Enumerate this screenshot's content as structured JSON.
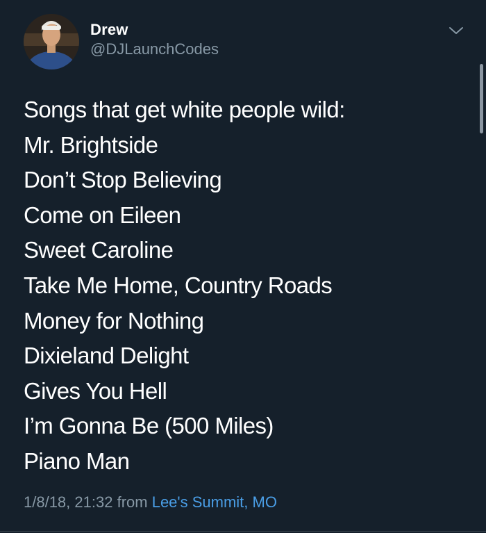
{
  "tweet": {
    "author": {
      "display_name": "Drew",
      "handle": "@DJLaunchCodes"
    },
    "menu_icon": "chevron-down-icon",
    "lines": [
      "Songs that get white people wild:",
      "Mr. Brightside",
      "Don’t Stop Believing",
      "Come on Eileen",
      "Sweet Caroline",
      "Take Me Home, Country Roads",
      "Money for Nothing",
      "Dixieland Delight",
      "Gives You Hell",
      "I’m Gonna Be (500 Miles)",
      "Piano Man"
    ],
    "timestamp": "1/8/18, 21:32",
    "from_label": "from",
    "location": "Lee's Summit, MO"
  },
  "colors": {
    "background": "#15202b",
    "text": "#ffffff",
    "secondary": "#8899a6",
    "link": "#4a9ee6"
  }
}
